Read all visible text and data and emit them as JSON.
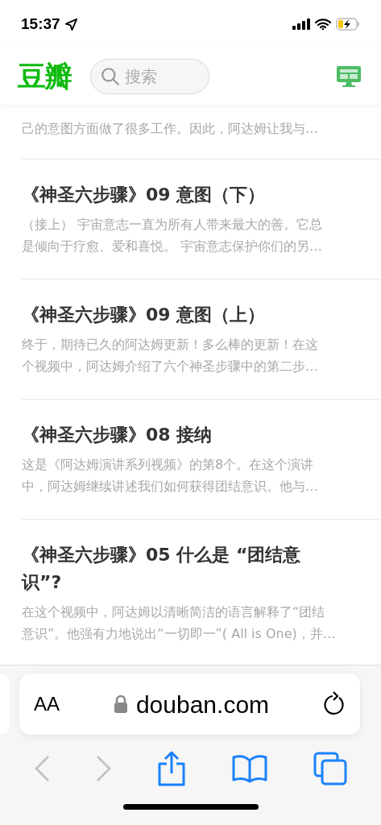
{
  "status_bar": {
    "time": "15:37"
  },
  "header": {
    "logo": "豆瓣",
    "search": {
      "placeholder": "搜索"
    }
  },
  "partial_item": {
    "description_lines": [
      "己的意图方面做了很多工作。因此，阿达姆让我与…"
    ]
  },
  "items": [
    {
      "title_lines": [
        "《神圣六步骤》09 意图（下）"
      ],
      "description_lines": [
        "（接上） 宇宙意志一直为所有人带来最大的善。它总",
        "是倾向于疗愈、爱和喜悦。 宇宙意志保护你们的另…"
      ]
    },
    {
      "title_lines": [
        "《神圣六步骤》09 意图（上）"
      ],
      "description_lines": [
        "终于，期待已久的阿达姆更新！多么棒的更新！在这",
        "个视频中，阿达姆介绍了六个神圣步骤中的第二步…"
      ]
    },
    {
      "title_lines": [
        "《神圣六步骤》08 接纳"
      ],
      "description_lines": [
        "这是《阿达姆演讲系列视频》的第8个。在这个演讲",
        "中，阿达姆继续讲述我们如何获得团结意识。他与…"
      ]
    },
    {
      "title_lines": [
        "《神圣六步骤》05 什么是 “团结意",
        "识”?"
      ],
      "description_lines": [
        "在这个视频中，阿达姆以清晰简洁的语言解释了“团结",
        "意识”。他强有力地说出“一切即一”( All is One)，并…"
      ]
    }
  ],
  "browser": {
    "text_size": "AA",
    "url": "douban.com"
  }
}
